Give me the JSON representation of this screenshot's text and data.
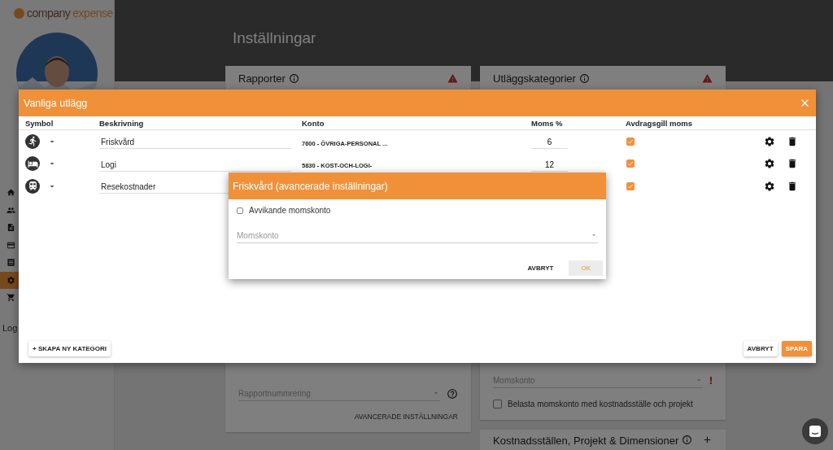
{
  "sidebar": {
    "logo": [
      "company",
      "expense"
    ],
    "nav": [
      {
        "selected": false
      },
      {
        "selected": false
      },
      {
        "selected": false
      },
      {
        "selected": false
      },
      {
        "selected": false
      },
      {
        "selected": true
      },
      {
        "selected": false
      }
    ],
    "logout": "Log"
  },
  "header": {
    "title": "Inställningar"
  },
  "cards": [
    {
      "title": "Rapporter",
      "warning": true,
      "select": {
        "placeholder": "Rapportnummrering"
      },
      "link": "AVANCERADE INSTÄLLNINGAR"
    },
    {
      "title": "Utläggskategorier",
      "warning": true,
      "select": {
        "placeholder": "Momskonto",
        "required_mark": "!"
      },
      "checkbox": {
        "label": "Belasta momskonto med kostnadsställe och projekt",
        "checked": false
      }
    }
  ],
  "next_card": {
    "title": "Kostnadsställen, Projekt & Dimensioner"
  },
  "modal": {
    "title": "Vanliga utlägg",
    "columns": [
      "Symbol",
      "Beskrivning",
      "Konto",
      "Moms %",
      "Avdragsgill moms"
    ],
    "rows": [
      {
        "description": "Friskvård",
        "account": "7600 - ÖVRIGA-PERSONAL ...",
        "vat": "6",
        "deductible": true
      },
      {
        "description": "Logi",
        "account": "5830 - KOST-OCH-LOGI-",
        "vat": "12",
        "deductible": true
      },
      {
        "description": "Resekostnader",
        "deductible": true
      }
    ],
    "create_button": "+ SKAPA NY KATEGORI",
    "buttons": [
      "AVBRYT",
      "SPARA"
    ]
  },
  "dialog": {
    "title": "Friskvård (avancerade inställningar)",
    "checkbox": {
      "label": "Avvikande momskonto",
      "checked": false
    },
    "select": {
      "placeholder": "Momskonto"
    },
    "buttons": [
      {
        "label": "AVBRYT",
        "disabled": false
      },
      {
        "label": "OK",
        "disabled": true
      }
    ]
  }
}
